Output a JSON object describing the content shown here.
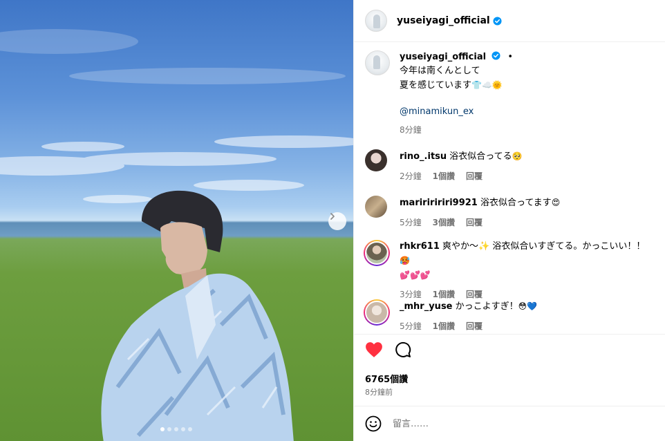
{
  "post": {
    "author": "yuseiyagi_official",
    "verified": true,
    "caption_dot": "•",
    "caption_line1": "今年は南くんとして",
    "caption_line2": "夏を感じています",
    "caption_emojis": "👕☁️🌞",
    "mention": "@minamikun_ex",
    "time": "8分鐘",
    "likes": "6765個讚",
    "posted_ago": "8分鐘前",
    "carousel": {
      "count": 5,
      "active_index": 0
    }
  },
  "comments": [
    {
      "user": "rino_.itsu",
      "text": "浴衣似合ってる",
      "emoji": "🥺",
      "time": "2分鐘",
      "likes": "1個讚",
      "reply": "回覆",
      "story_ring": false
    },
    {
      "user": "maririririri9921",
      "text": "浴衣似合ってます",
      "emoji": "😍",
      "time": "5分鐘",
      "likes": "3個讚",
      "reply": "回覆",
      "story_ring": false
    },
    {
      "user": "rhkr611",
      "text": "爽やか〜✨ 浴衣似合いすぎてる。かっこいい！！",
      "emoji": "🥵",
      "emoji_line2": "💕💕💕",
      "time": "3分鐘",
      "likes": "1個讚",
      "reply": "回覆",
      "story_ring": true
    },
    {
      "user": "_mhr_yuse",
      "text": "かっこよすぎ！",
      "emoji": "😳💙",
      "time": "5分鐘",
      "likes": "1個讚",
      "reply": "回覆",
      "story_ring": true
    }
  ],
  "composer": {
    "placeholder": "留言……"
  },
  "icons": {
    "like": "heart-filled-icon",
    "comment": "comment-bubble-icon",
    "emoji": "emoji-icon",
    "next": "chevron-right-icon",
    "verified": "verified-badge-icon"
  },
  "colors": {
    "like": "#ff3040",
    "verified": "#0095f6",
    "mention": "#00376b"
  }
}
